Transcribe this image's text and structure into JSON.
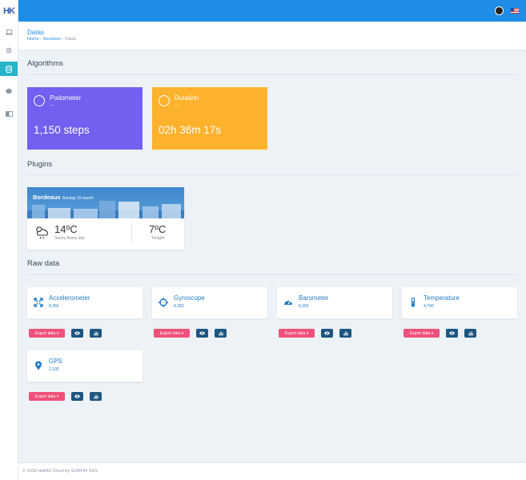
{
  "brand": {
    "logo": "HK"
  },
  "header": {
    "title": "Datas",
    "breadcrumb": [
      "Home",
      "Sessions",
      "Datas"
    ]
  },
  "sections": {
    "algorithms": "Algorithms",
    "plugins": "Plugins",
    "raw_data": "Raw data"
  },
  "algorithms": [
    {
      "name": "Podometer",
      "sub": "—",
      "value": "1,150 steps",
      "color": "#7360f0",
      "icon": "pie-chart-icon"
    },
    {
      "name": "Duration",
      "sub": "—",
      "value": "02h 36m 17s",
      "color": "#fdb22e",
      "icon": "timer-icon"
    }
  ],
  "weather": {
    "city": "Bordeaux",
    "date": "Sunday 15 march",
    "temp": "14ºC",
    "condition": "Sunny Rainy day",
    "night_temp": "7ºC",
    "night_label": "Tonight"
  },
  "raw_data": [
    {
      "name": "Accelerometer",
      "count": "8,350",
      "icon": "expand-arrows-icon"
    },
    {
      "name": "Gyroscope",
      "count": "8,350",
      "icon": "crosshair-icon"
    },
    {
      "name": "Barometer",
      "count": "8,350",
      "icon": "gauge-icon"
    },
    {
      "name": "Temperature",
      "count": "4,740",
      "icon": "thermometer-icon"
    },
    {
      "name": "GPS",
      "count": "2,190",
      "icon": "map-pin-icon"
    }
  ],
  "actions": {
    "export": "Export data ▾"
  },
  "footer": {
    "text": "© 2018 HubKit Cloud by SURFIN SAS"
  },
  "colors": {
    "topbar": "#1f8de5",
    "accent": "#25b5c9",
    "export": "#f0507a",
    "action": "#1d5680"
  }
}
